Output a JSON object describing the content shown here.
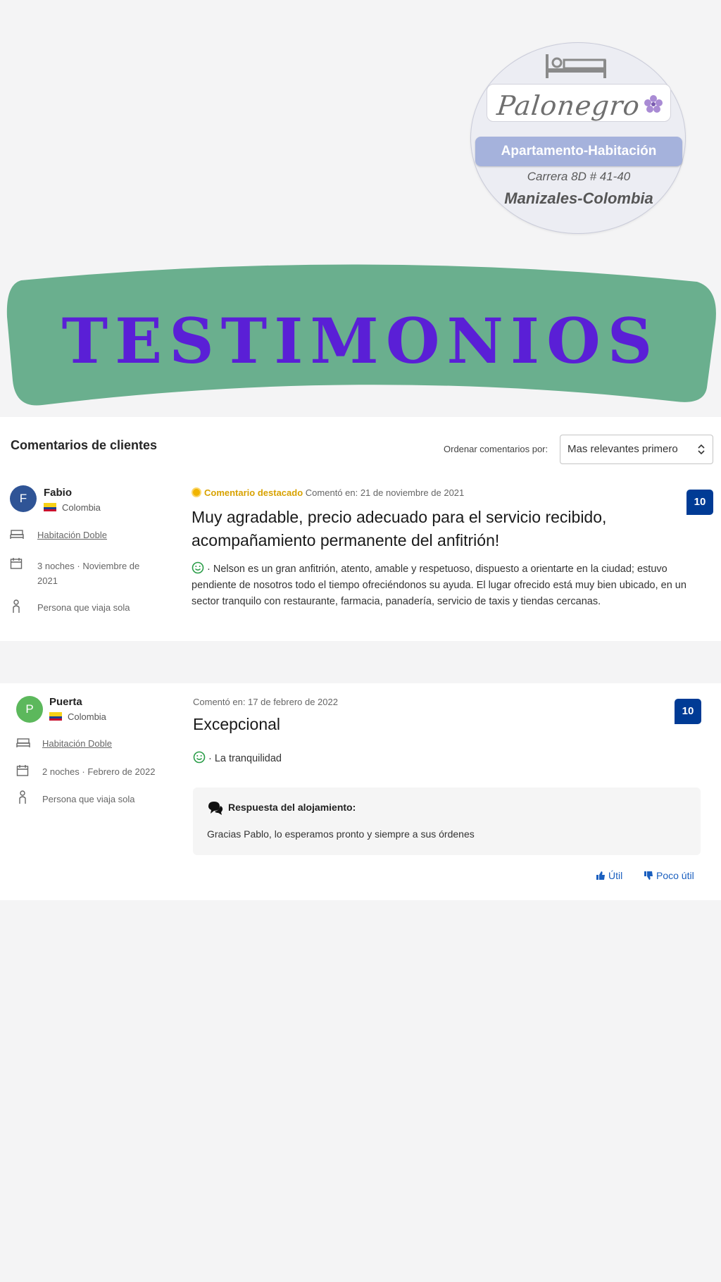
{
  "logo": {
    "name": "Palonegro",
    "subtitle": "Apartamento-Habitación",
    "address": "Carrera 8D # 41-40",
    "city": "Manizales-Colombia"
  },
  "banner": {
    "title": "TESTIMONIOS"
  },
  "reviews_section": {
    "title": "Comentarios de clientes",
    "sort_label": "Ordenar comentarios por:",
    "sort_value": "Mas relevantes primero"
  },
  "reviews": [
    {
      "initial": "F",
      "author": "Fabio",
      "country": "Colombia",
      "room": "Habitación Doble",
      "stay": "3 noches · Noviembre de 2021",
      "traveler": "Persona que viaja sola",
      "featured_label": "Comentario destacado",
      "date": "Comentó en: 21 de noviembre de 2021",
      "title": "Muy agradable, precio adecuado para el servicio recibido, acompañamiento permanente del anfitrión!",
      "body": "· Nelson es un gran anfitrión, atento, amable y respetuoso, dispuesto a orientarte en la ciudad; estuvo pendiente de nosotros todo el tiempo ofreciéndonos su ayuda. El lugar ofrecido está muy bien ubicado, en un sector tranquilo con restaurante, farmacia, panadería, servicio de taxis y tiendas cercanas.",
      "score": "10",
      "avatar_color": "#2f5496"
    },
    {
      "initial": "P",
      "author": "Puerta",
      "country": "Colombia",
      "room": "Habitación Doble",
      "stay": "2 noches · Febrero de 2022",
      "traveler": "Persona que viaja sola",
      "date": "Comentó en: 17 de febrero de 2022",
      "title": "Excepcional",
      "body": "· La tranquilidad",
      "score": "10",
      "avatar_color": "#5cb85c",
      "response_heading": "Respuesta del alojamiento:",
      "response_text": "Gracias Pablo, lo esperamos pronto y siempre a sus órdenes",
      "helpful_label": "Útil",
      "not_helpful_label": "Poco útil"
    }
  ],
  "colors": {
    "banner_green": "#6aaf8e",
    "banner_text": "#5a1fd6",
    "score_bg": "#003b95",
    "link_blue": "#1a5fbf",
    "featured_gold": "#d8a200"
  }
}
